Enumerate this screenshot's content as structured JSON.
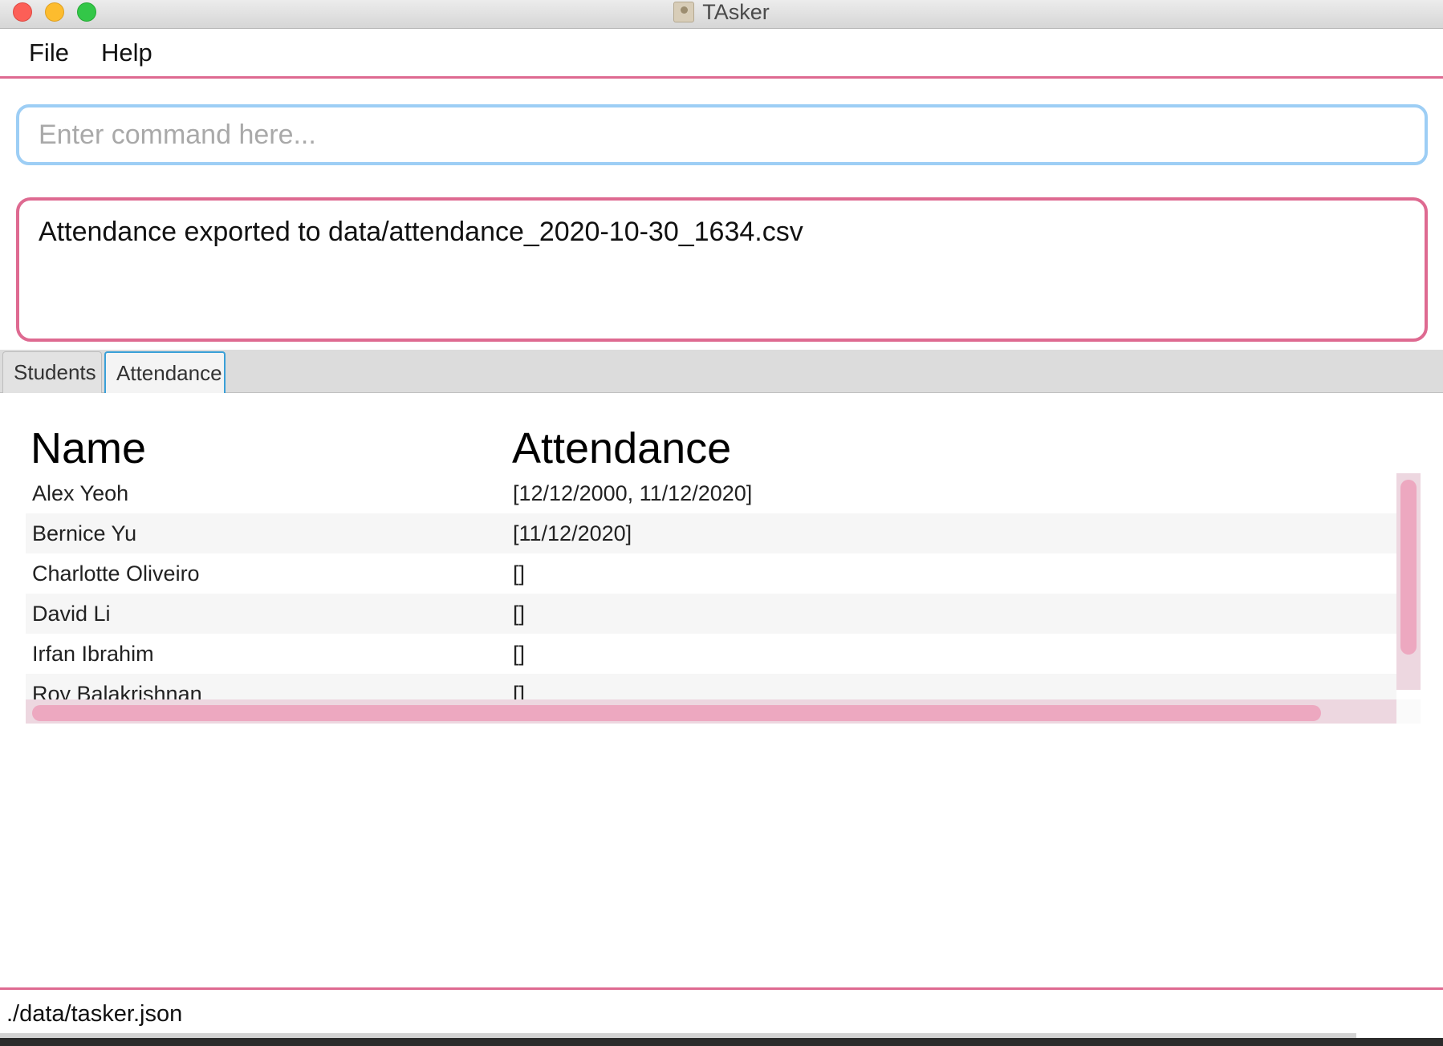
{
  "window": {
    "title": "TAsker"
  },
  "menu": {
    "items": [
      "File",
      "Help"
    ]
  },
  "command": {
    "placeholder": "Enter command here...",
    "value": ""
  },
  "result": {
    "message": "Attendance exported to data/attendance_2020-10-30_1634.csv"
  },
  "tabs": [
    {
      "label": "Students",
      "selected": false
    },
    {
      "label": "Attendance",
      "selected": true
    }
  ],
  "table": {
    "headers": {
      "name": "Name",
      "attendance": "Attendance"
    },
    "rows": [
      {
        "name": "Alex Yeoh",
        "attendance": "[12/12/2000, 11/12/2020]"
      },
      {
        "name": "Bernice Yu",
        "attendance": "[11/12/2020]"
      },
      {
        "name": "Charlotte Oliveiro",
        "attendance": "[]"
      },
      {
        "name": "David Li",
        "attendance": "[]"
      },
      {
        "name": "Irfan Ibrahim",
        "attendance": "[]"
      },
      {
        "name": "Roy Balakrishnan",
        "attendance": "[]"
      }
    ]
  },
  "status": {
    "file_path": "./data/tasker.json"
  },
  "colors": {
    "accent_pink": "#de6a91",
    "command_border": "#9dcef5",
    "tab_selected_border": "#3aa0d8",
    "scrollbar_thumb": "#eda8c0"
  }
}
